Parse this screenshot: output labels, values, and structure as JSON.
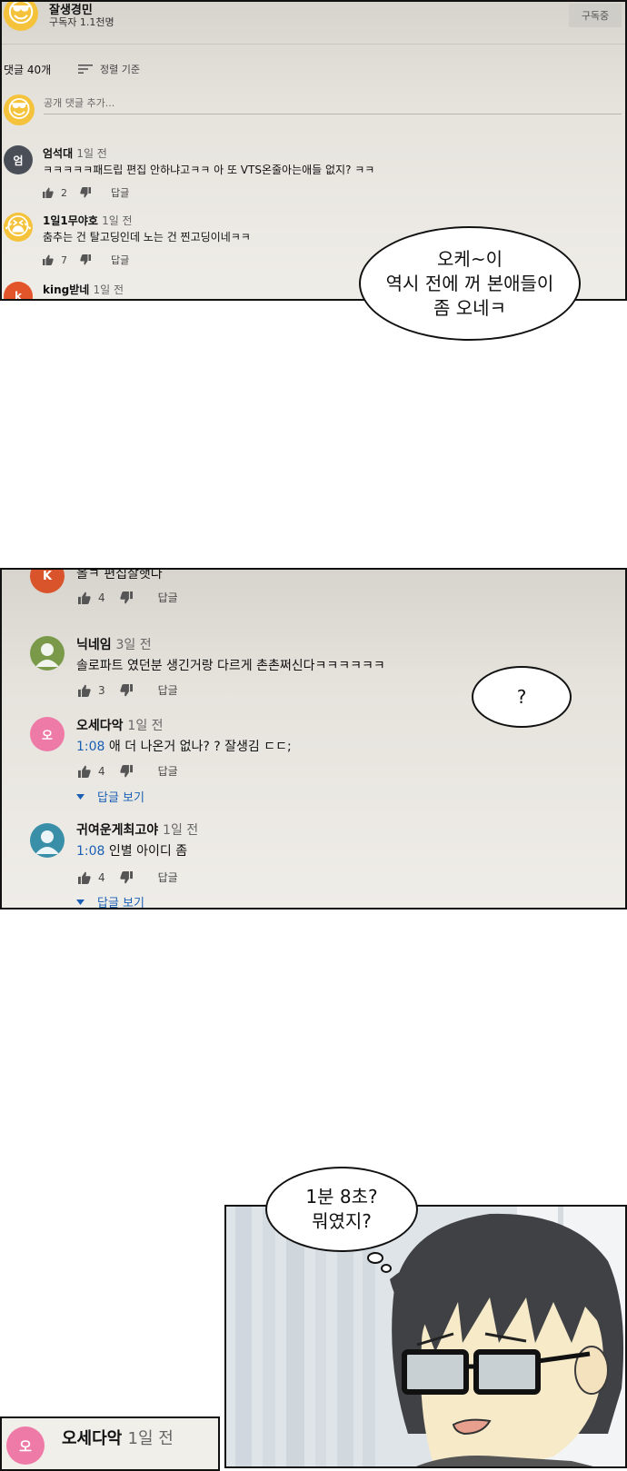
{
  "panel1": {
    "channel_name": "잘생경민",
    "subscribers": "구독자 1.1천명",
    "subscribe_button": "구독중",
    "comment_count": "댓글 40개",
    "sort_label": "정렬 기준",
    "add_comment_placeholder": "공개 댓글 추가...",
    "comments": [
      {
        "author": "엄석대",
        "ago": "1일 전",
        "avatar_letter": "엄",
        "avatar_color": "#4a4f57",
        "text": "ㅋㅋㅋㅋㅋ패드립 편집 안하냐고ㅋㅋ 아 또 VTS온줄아는애들 없지? ㅋㅋ",
        "likes": "2",
        "reply": "답글"
      },
      {
        "author": "1일1무야호",
        "ago": "1일 전",
        "avatar_emoji": "😭",
        "text": "춤추는 건 탈고딩인데 노는 건 찐고딩이네ㅋㅋ",
        "likes": "7",
        "reply": "답글"
      },
      {
        "author": "king받네",
        "ago": "1일 전",
        "avatar_letter": "k",
        "avatar_color": "#e2542a"
      }
    ],
    "bubble_lines": [
      "오케~이",
      "역시 전에 꺼 본애들이",
      "좀 오네ㅋ"
    ]
  },
  "panel2": {
    "comments": [
      {
        "avatar_letter": "K",
        "avatar_color": "#d9532b",
        "text": "올ㅋ 편집잘햇다",
        "likes": "4",
        "reply": "답글"
      },
      {
        "author": "닉네임",
        "ago": "3일 전",
        "avatar_color": "#7a9a4a",
        "text": "솔로파트 였던분 생긴거랑 다르게 촌촌쩌신다ㅋㅋㅋㅋㅋㅋ",
        "likes": "3",
        "reply": "답글"
      },
      {
        "author": "오세다악",
        "ago": "1일 전",
        "avatar_letter": "오",
        "avatar_color": "#ee7aa7",
        "timestamp": "1:08",
        "text": " 애 더 나온거 없나? ? 잘생김 ㄷㄷ;",
        "likes": "4",
        "reply": "답글",
        "view_replies": "답글 보기"
      },
      {
        "author": "귀여운게최고야",
        "ago": "1일 전",
        "avatar_color": "#3a8fa8",
        "timestamp": "1:08",
        "text": " 인별 아이디 좀",
        "likes": "4",
        "reply": "답글",
        "view_replies": "답글 보기"
      }
    ],
    "bubble_text": "?"
  },
  "panel3": {
    "bubble_lines": [
      "1분 8초?",
      "뭐였지?"
    ],
    "comment_author": "오세다악",
    "comment_ago": "1일 전",
    "comment_avatar_letter": "오"
  }
}
